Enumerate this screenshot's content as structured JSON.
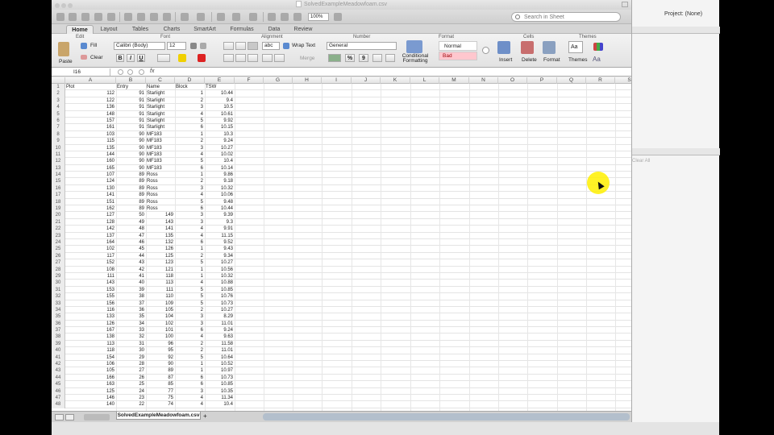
{
  "window": {
    "title": "SolvedExampleMeadowfoam.csv"
  },
  "toolbar": {
    "zoom": "100%",
    "search_placeholder": "Search in Sheet"
  },
  "tabs": [
    "Home",
    "Layout",
    "Tables",
    "Charts",
    "SmartArt",
    "Formulas",
    "Data",
    "Review"
  ],
  "ribbon": {
    "groups": {
      "edit": "Edit",
      "font": "Font",
      "alignment": "Alignment",
      "number": "Number",
      "format": "Format",
      "cells": "Cells",
      "themes": "Themes"
    },
    "paste": "Paste",
    "fill": "Fill",
    "clear": "Clear",
    "font_name": "Calibri (Body)",
    "font_size": "12",
    "bold": "B",
    "italic": "I",
    "underline": "U",
    "abc": "abc",
    "wrap_text": "Wrap Text",
    "merge": "Merge",
    "number_format": "General",
    "percent": "%",
    "comma": "9",
    "conditional_formatting": "Conditional Formatting",
    "style_normal": "Normal",
    "style_bad": "Bad",
    "insert": "Insert",
    "delete": "Delete",
    "format": "Format",
    "themes": "Themes",
    "themes_font": "Aa",
    "aa_label": "Aa"
  },
  "formula_bar": {
    "cell_ref": "I16",
    "fx": "fx",
    "content": ""
  },
  "grid": {
    "columns": [
      "A",
      "B",
      "C",
      "D",
      "E",
      "F",
      "G",
      "H",
      "I",
      "J",
      "K",
      "L",
      "M",
      "N",
      "O",
      "P",
      "Q",
      "R",
      "S"
    ],
    "headers": [
      "Plot",
      "Entry",
      "Name",
      "Block",
      "TSW"
    ],
    "rows": [
      [
        "112",
        "91",
        "Starlight",
        "1",
        "10.44"
      ],
      [
        "122",
        "91",
        "Starlight",
        "2",
        "9.4"
      ],
      [
        "136",
        "91",
        "Starlight",
        "3",
        "10.5"
      ],
      [
        "148",
        "91",
        "Starlight",
        "4",
        "10.61"
      ],
      [
        "157",
        "91",
        "Starlight",
        "5",
        "9.92"
      ],
      [
        "161",
        "91",
        "Starlight",
        "6",
        "10.15"
      ],
      [
        "103",
        "90",
        "MF183",
        "1",
        "10.3"
      ],
      [
        "115",
        "90",
        "MF183",
        "2",
        "9.24"
      ],
      [
        "135",
        "90",
        "MF183",
        "3",
        "10.27"
      ],
      [
        "144",
        "90",
        "MF183",
        "4",
        "10.02"
      ],
      [
        "160",
        "90",
        "MF183",
        "5",
        "10.4"
      ],
      [
        "165",
        "90",
        "MF183",
        "6",
        "10.14"
      ],
      [
        "107",
        "89",
        "Ross",
        "1",
        "9.86"
      ],
      [
        "124",
        "89",
        "Ross",
        "2",
        "9.18"
      ],
      [
        "130",
        "89",
        "Ross",
        "3",
        "10.32"
      ],
      [
        "141",
        "89",
        "Ross",
        "4",
        "10.06"
      ],
      [
        "151",
        "89",
        "Ross",
        "5",
        "9.48"
      ],
      [
        "162",
        "89",
        "Ross",
        "6",
        "10.44"
      ],
      [
        "127",
        "50",
        "149",
        "3",
        "9.39"
      ],
      [
        "128",
        "49",
        "143",
        "3",
        "9.3"
      ],
      [
        "142",
        "48",
        "141",
        "4",
        "9.91"
      ],
      [
        "137",
        "47",
        "135",
        "4",
        "11.15"
      ],
      [
        "164",
        "46",
        "132",
        "6",
        "9.52"
      ],
      [
        "102",
        "45",
        "126",
        "1",
        "9.43"
      ],
      [
        "117",
        "44",
        "125",
        "2",
        "9.34"
      ],
      [
        "152",
        "43",
        "123",
        "5",
        "10.27"
      ],
      [
        "108",
        "42",
        "121",
        "1",
        "10.56"
      ],
      [
        "111",
        "41",
        "118",
        "1",
        "10.32"
      ],
      [
        "143",
        "40",
        "113",
        "4",
        "10.88"
      ],
      [
        "153",
        "39",
        "111",
        "5",
        "10.85"
      ],
      [
        "155",
        "38",
        "110",
        "5",
        "10.76"
      ],
      [
        "156",
        "37",
        "109",
        "5",
        "10.73"
      ],
      [
        "116",
        "36",
        "105",
        "2",
        "10.27"
      ],
      [
        "133",
        "35",
        "104",
        "3",
        "8.29"
      ],
      [
        "126",
        "34",
        "102",
        "3",
        "11.01"
      ],
      [
        "167",
        "33",
        "101",
        "6",
        "9.24"
      ],
      [
        "138",
        "32",
        "100",
        "4",
        "9.63"
      ],
      [
        "113",
        "31",
        "96",
        "2",
        "11.58"
      ],
      [
        "118",
        "30",
        "95",
        "2",
        "11.01"
      ],
      [
        "154",
        "29",
        "92",
        "5",
        "10.64"
      ],
      [
        "106",
        "28",
        "90",
        "1",
        "10.52"
      ],
      [
        "105",
        "27",
        "89",
        "1",
        "10.97"
      ],
      [
        "166",
        "26",
        "87",
        "6",
        "10.73"
      ],
      [
        "163",
        "25",
        "85",
        "6",
        "10.85"
      ],
      [
        "125",
        "24",
        "77",
        "3",
        "10.35"
      ],
      [
        "146",
        "23",
        "75",
        "4",
        "11.34"
      ],
      [
        "140",
        "22",
        "74",
        "4",
        "10.4"
      ]
    ]
  },
  "sheet_tab": "SolvedExampleMeadowfoam.csv",
  "add_sheet": "+",
  "side_panel": {
    "project": "Project: (None)",
    "clear_all": "Clear All"
  },
  "colors": {
    "accent": "#ffd700",
    "bad_fill": "#ffc7ce",
    "bad_text": "#9c0006"
  }
}
